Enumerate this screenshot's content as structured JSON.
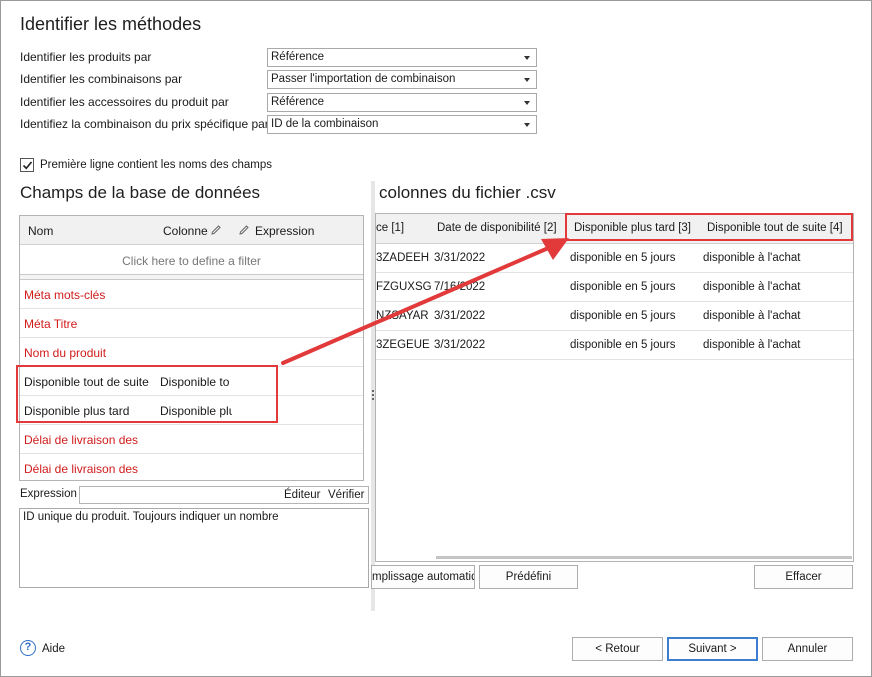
{
  "title": "Identifier les méthodes",
  "identify": {
    "rows": [
      {
        "label": "Identifier les produits par",
        "value": "Référence"
      },
      {
        "label": "Identifier les combinaisons par",
        "value": "Passer l'importation de combinaison"
      },
      {
        "label": "Identifier les accessoires du produit par",
        "value": "Référence"
      },
      {
        "label": "Identifiez la combinaison du prix spécifique par",
        "value": "ID de la combinaison"
      }
    ]
  },
  "first_line_checkbox": {
    "label": "Première ligne contient les noms des champs",
    "checked": true
  },
  "db_fields": {
    "title": "Champs de la base de données",
    "headers": {
      "name": "Nom",
      "column": "Colonne",
      "expression": "Expression"
    },
    "filter_text": "Click here to define a filter",
    "rows": [
      {
        "name": "Méta mots-clés",
        "column": "",
        "required": true
      },
      {
        "name": "Méta Titre",
        "column": "",
        "required": true
      },
      {
        "name": "Nom du produit",
        "column": "",
        "required": true
      },
      {
        "name": "Disponible tout de suite",
        "column": "Disponible to",
        "required": false
      },
      {
        "name": "Disponible plus tard",
        "column": "Disponible plu",
        "required": false
      },
      {
        "name": "Délai de livraison des",
        "column": "",
        "required": true
      },
      {
        "name": "Délai de livraison des",
        "column": "",
        "required": true
      }
    ],
    "expression_label": "Expression",
    "editor_button": "Éditeur",
    "verify_button": "Vérifier",
    "description": "ID unique du produit. Toujours indiquer un nombre"
  },
  "csv": {
    "title": "colonnes du fichier .csv",
    "headers": [
      "ce [1]",
      "Date de disponibilité [2]",
      "Disponible plus tard [3]",
      "Disponible tout de suite [4]"
    ],
    "rows": [
      [
        "3ZADEEH",
        "3/31/2022",
        "disponible en 5 jours",
        "disponible à l'achat"
      ],
      [
        "FZGUXSG",
        "7/16/2022",
        "disponible en 5 jours",
        "disponible à l'achat"
      ],
      [
        "NZSAYAR",
        "3/31/2022",
        "disponible en 5 jours",
        "disponible à l'achat"
      ],
      [
        "3ZEGEUE",
        "3/31/2022",
        "disponible en 5 jours",
        "disponible à l'achat"
      ]
    ],
    "autofill_button": "mplissage automatiq",
    "predefined_button": "Prédéfini",
    "clear_button": "Effacer"
  },
  "footer": {
    "help": "Aide",
    "back": "< Retour",
    "next": "Suivant >",
    "cancel": "Annuler"
  },
  "colors": {
    "required_field": "#d11b1b",
    "highlight": "#e23a3a",
    "accent": "#3c7fd0"
  }
}
